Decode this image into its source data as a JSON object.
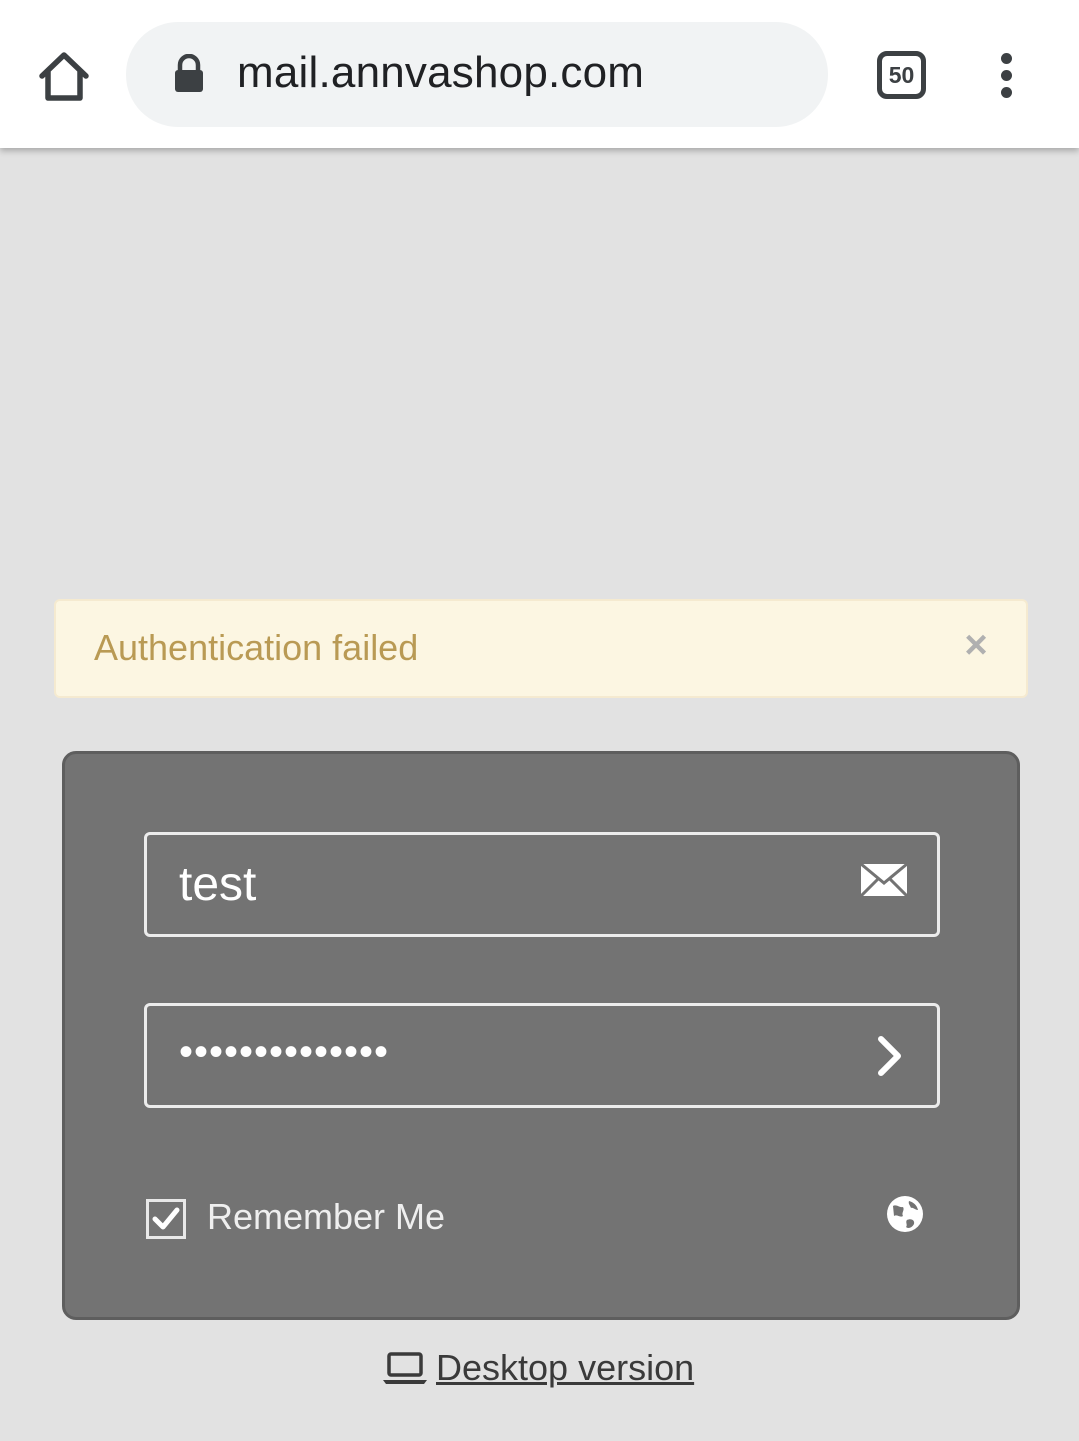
{
  "browser": {
    "url": "mail.annvashop.com",
    "tab_count": "50",
    "icons": [
      "home-icon",
      "lock-icon",
      "tabs-icon",
      "more-vert-icon"
    ]
  },
  "alert": {
    "message": "Authentication failed",
    "close_symbol": "×",
    "colors": {
      "background": "#fcf6e2",
      "text": "#b99a54"
    }
  },
  "login": {
    "username_value": "test",
    "password_value": "••••••••••••••",
    "remember_me_label": "Remember Me",
    "remember_me_checked": true,
    "icons": [
      "envelope-icon",
      "chevron-right-icon",
      "globe-icon"
    ],
    "panel_color": "#737373"
  },
  "footer": {
    "desktop_version_label": "Desktop version",
    "icon": "laptop-icon"
  }
}
